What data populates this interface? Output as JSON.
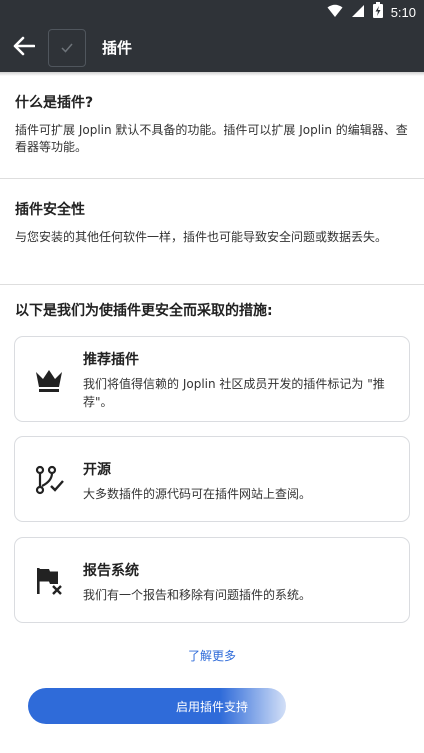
{
  "status_bar": {
    "time": "5:10"
  },
  "app_bar": {
    "title": "插件"
  },
  "sections": [
    {
      "title": "什么是插件?",
      "text": "插件可扩展 Joplin 默认不具备的功能。插件可以扩展 Joplin 的编辑器、查看器等功能。"
    },
    {
      "title": "插件安全性",
      "text": "与您安装的其他任何软件一样，插件也可能导致安全问题或数据丢失。"
    }
  ],
  "measures": {
    "title": "以下是我们为使插件更安全而采取的措施:",
    "cards": [
      {
        "icon": "crown-icon",
        "title": "推荐插件",
        "desc": "我们将值得信赖的 Joplin 社区成员开发的插件标记为 \"推荐\"。"
      },
      {
        "icon": "source-branch-check-icon",
        "title": "开源",
        "desc": "大多数插件的源代码可在插件网站上查阅。"
      },
      {
        "icon": "flag-remove-icon",
        "title": "报告系统",
        "desc": "我们有一个报告和移除有问题插件的系统。"
      }
    ]
  },
  "learn_more": "了解更多",
  "enable_button": "启用插件支持",
  "colors": {
    "app_bar": "#2f3338",
    "accent": "#2f6bd9"
  }
}
